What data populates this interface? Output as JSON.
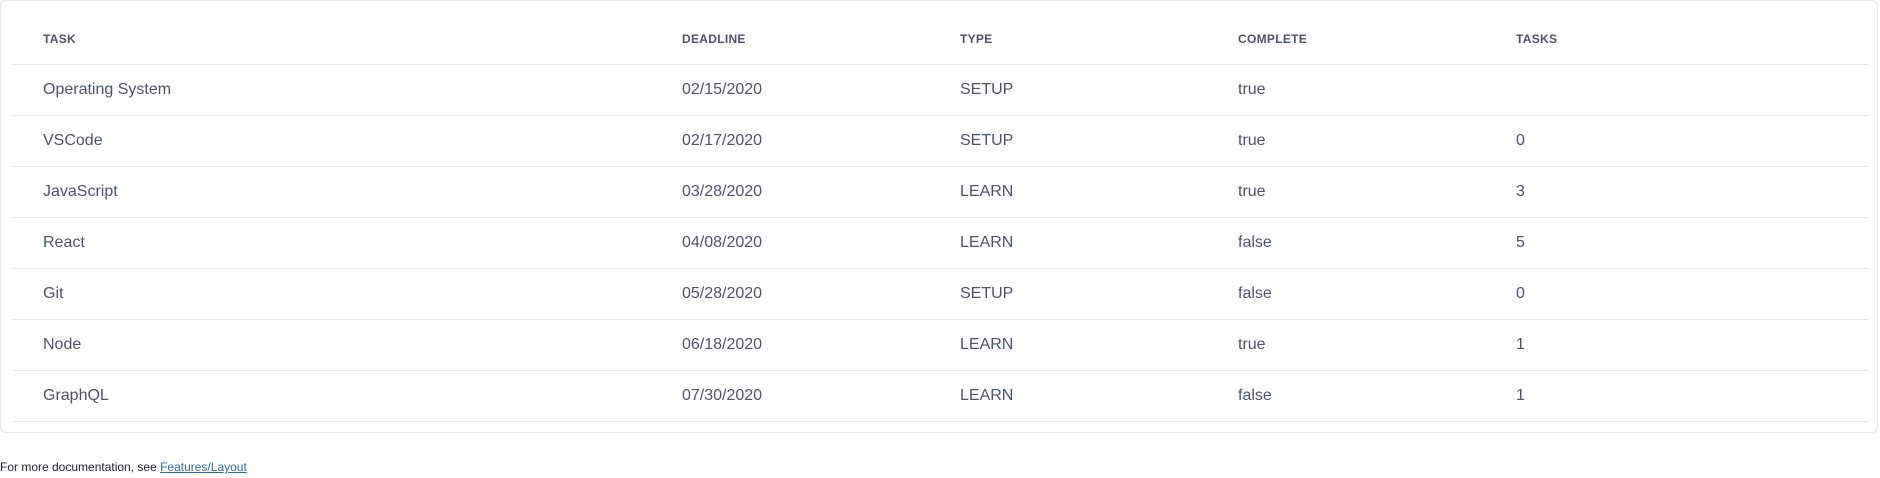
{
  "table": {
    "columns": [
      "TASK",
      "DEADLINE",
      "TYPE",
      "COMPLETE",
      "TASKS"
    ],
    "rows": [
      {
        "task": "Operating System",
        "deadline": "02/15/2020",
        "type": "SETUP",
        "complete": "true",
        "tasks": ""
      },
      {
        "task": "VSCode",
        "deadline": "02/17/2020",
        "type": "SETUP",
        "complete": "true",
        "tasks": "0"
      },
      {
        "task": "JavaScript",
        "deadline": "03/28/2020",
        "type": "LEARN",
        "complete": "true",
        "tasks": "3"
      },
      {
        "task": "React",
        "deadline": "04/08/2020",
        "type": "LEARN",
        "complete": "false",
        "tasks": "5"
      },
      {
        "task": "Git",
        "deadline": "05/28/2020",
        "type": "SETUP",
        "complete": "false",
        "tasks": "0"
      },
      {
        "task": "Node",
        "deadline": "06/18/2020",
        "type": "LEARN",
        "complete": "true",
        "tasks": "1"
      },
      {
        "task": "GraphQL",
        "deadline": "07/30/2020",
        "type": "LEARN",
        "complete": "false",
        "tasks": "1"
      }
    ]
  },
  "footer": {
    "text": "For more documentation, see ",
    "link_label": "Features/Layout"
  },
  "colors": {
    "text": "#4a5568",
    "border": "#e2e8f0",
    "link": "#2b6cb0"
  }
}
